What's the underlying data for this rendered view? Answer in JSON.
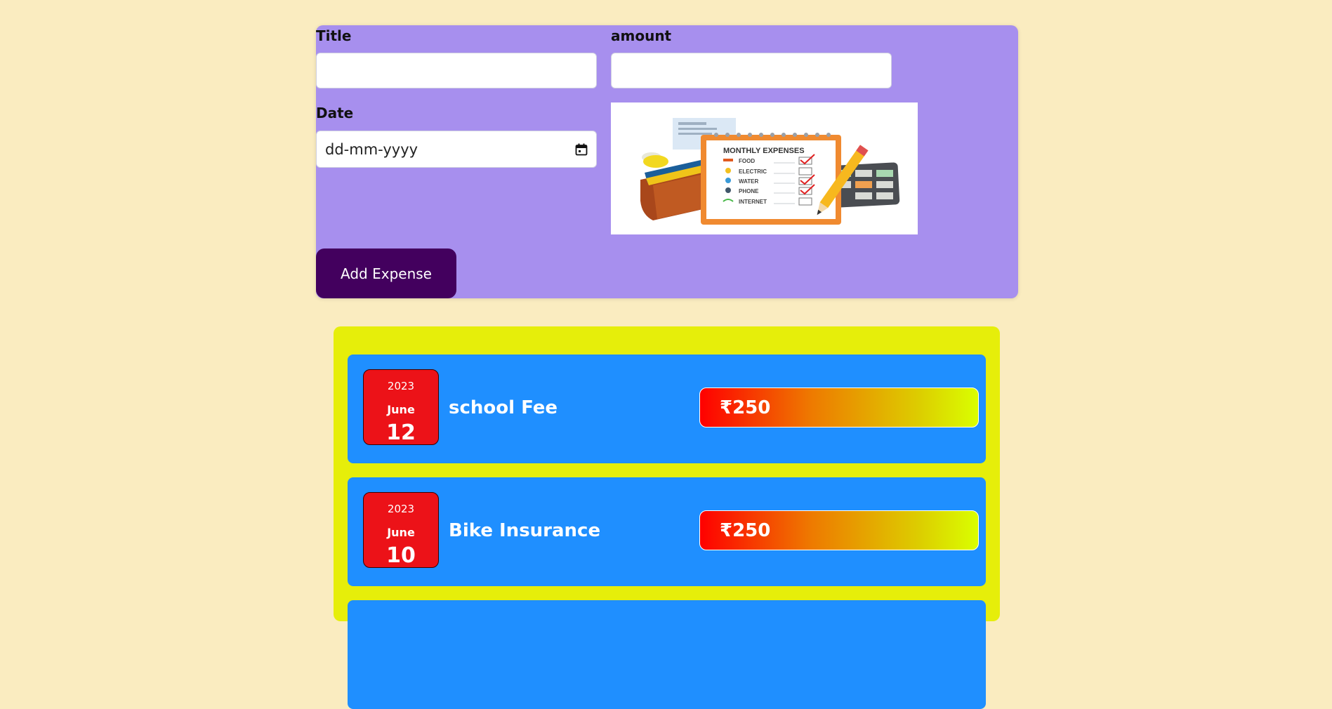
{
  "form": {
    "title_label": "Title",
    "title_value": "",
    "amount_label": "amount",
    "amount_value": "",
    "date_label": "Date",
    "date_placeholder": "dd-mm-yyyy",
    "submit_label": "Add Expense",
    "illustration": {
      "heading": "MONTHLY EXPENSES",
      "rows": [
        "FOOD",
        "ELECTRIC",
        "WATER",
        "PHONE",
        "INTERNET"
      ]
    }
  },
  "expenses": [
    {
      "year": "2023",
      "month": "June",
      "day": "12",
      "title": "school Fee",
      "amount": "₹250"
    },
    {
      "year": "2023",
      "month": "June",
      "day": "10",
      "title": "Bike Insurance",
      "amount": "₹250"
    }
  ],
  "colors": {
    "page_background": "#faecc0",
    "form_background": "#a78fee",
    "button_background": "#43005e",
    "list_background": "#e6ee0a",
    "item_background": "#1f8fff",
    "date_badge": "#ec1218"
  }
}
